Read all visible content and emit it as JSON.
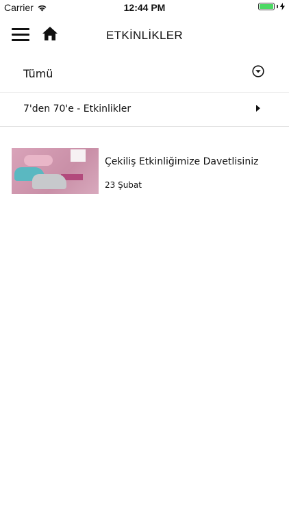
{
  "status_bar": {
    "carrier": "Carrier",
    "time": "12:44 PM",
    "battery_level": 1.0
  },
  "nav": {
    "title": "ETKİNLİKLER",
    "menu_icon": "hamburger-menu-icon",
    "home_icon": "home-icon"
  },
  "filters": {
    "all_label": "Tümü",
    "category_label": "7'den 70'e - Etkinlikler"
  },
  "events": [
    {
      "title": "Çekiliş Etkinliğimize Davetlisiniz",
      "date": "23 Şubat"
    }
  ],
  "colors": {
    "battery": "#4cd964",
    "divider": "#e2e2e2"
  }
}
